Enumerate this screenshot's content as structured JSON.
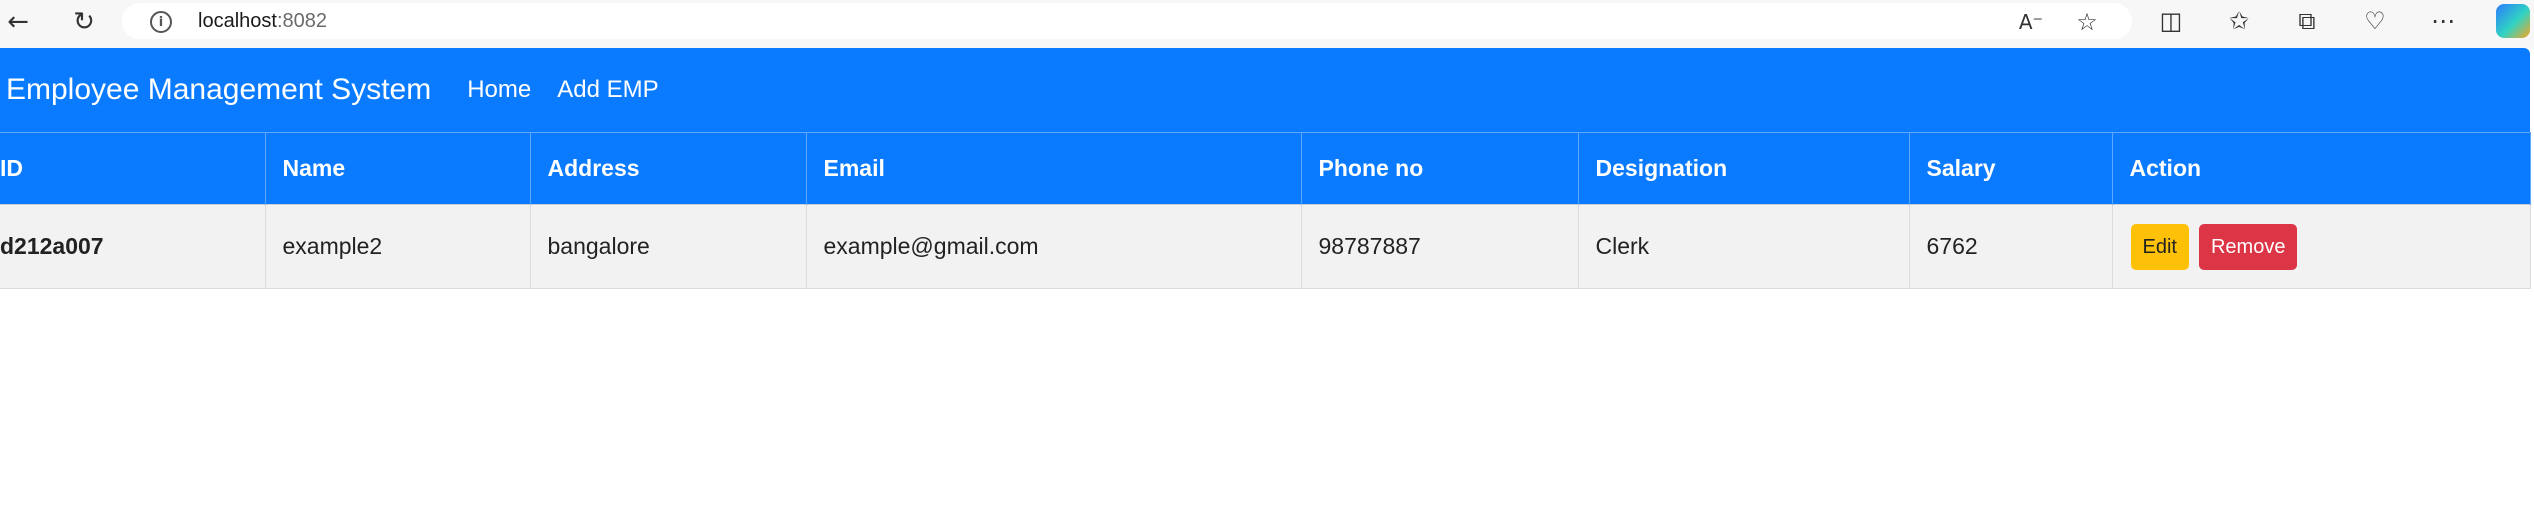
{
  "browser": {
    "url_host": "localhost",
    "url_port": ":8082",
    "icons": [
      "back-icon",
      "refresh-icon",
      "info-icon",
      "read-aloud-icon",
      "favorite-star-icon",
      "split-screen-icon",
      "favorites-icon",
      "collections-icon",
      "browser-essentials-icon",
      "more-icon",
      "copilot-icon"
    ]
  },
  "navbar": {
    "brand": "Employee Management System",
    "links": [
      "Home",
      "Add EMP"
    ]
  },
  "table": {
    "headers": [
      "ID",
      "Name",
      "Address",
      "Email",
      "Phone no",
      "Designation",
      "Salary",
      "Action"
    ],
    "rows": [
      {
        "id": "d212a007",
        "name": "example2",
        "address": "bangalore",
        "email": "example@gmail.com",
        "phone": "98787887",
        "designation": "Clerk",
        "salary": "6762",
        "edit_label": "Edit",
        "remove_label": "Remove"
      }
    ]
  },
  "colors": {
    "primary": "#0a7bff",
    "edit_button": "#ffc107",
    "remove_button": "#dc3545",
    "row_background": "#f2f2f2"
  }
}
